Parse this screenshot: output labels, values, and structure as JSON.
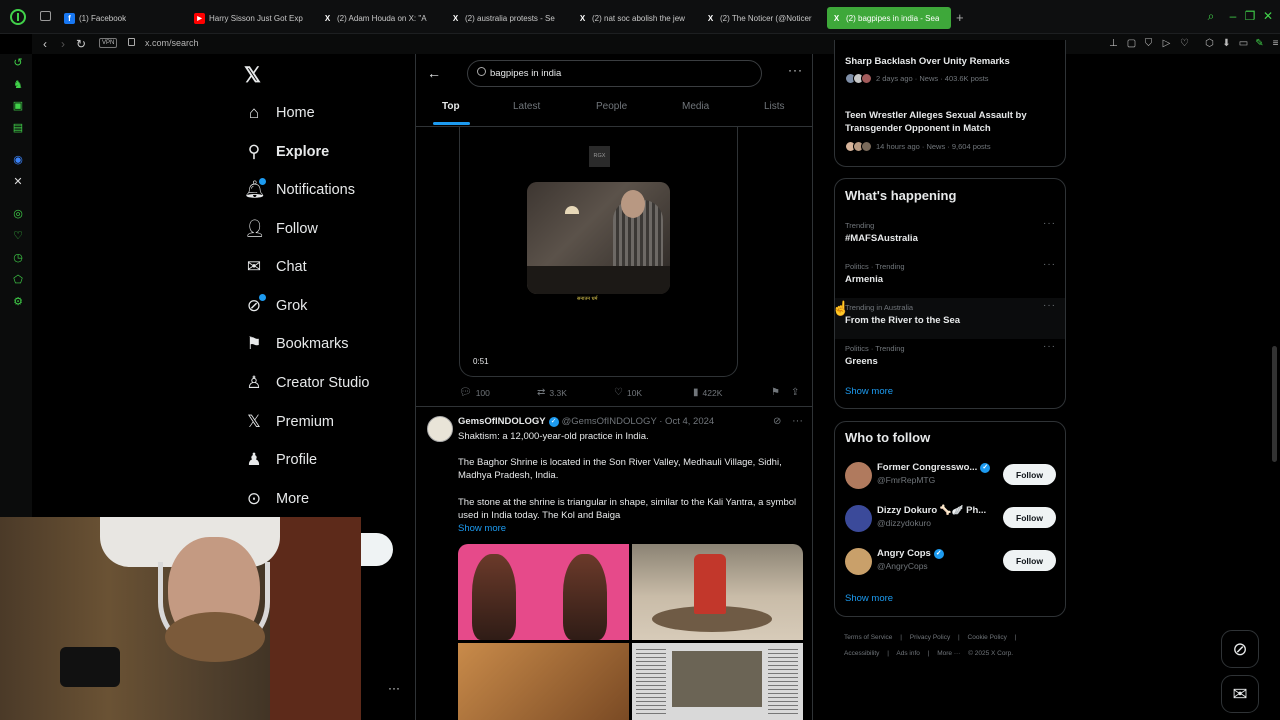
{
  "browser": {
    "tabs": [
      {
        "label": "(1) Facebook",
        "icon_color": "#1877f2",
        "icon": "f"
      },
      {
        "label": "Harry Sisson Just Got Exp",
        "icon_color": "#ff0000",
        "icon": "▶"
      },
      {
        "label": "(2) Adam Houda on X: \"A",
        "icon_color": "#000000",
        "icon": "X"
      },
      {
        "label": "(2) australia protests - Se",
        "icon_color": "#000000",
        "icon": "X"
      },
      {
        "label": "(2) nat soc abolish the jew",
        "icon_color": "#000000",
        "icon": "X"
      },
      {
        "label": "(2) The Noticer (@Noticer",
        "icon_color": "#000000",
        "icon": "X"
      },
      {
        "label": "(2) bagpipes in india - Sea",
        "icon_color": "#000000",
        "icon": "X"
      }
    ],
    "url": "x.com/search",
    "vpn_label": "VPN",
    "accent": "#41d24a"
  },
  "nav": {
    "items": [
      {
        "label": "Home",
        "icon": "home-icon"
      },
      {
        "label": "Explore",
        "icon": "explore-icon"
      },
      {
        "label": "Notifications",
        "icon": "bell-icon"
      },
      {
        "label": "Follow",
        "icon": "follow-icon"
      },
      {
        "label": "Chat",
        "icon": "mail-icon"
      },
      {
        "label": "Grok",
        "icon": "grok-icon"
      },
      {
        "label": "Bookmarks",
        "icon": "bookmark-icon"
      },
      {
        "label": "Creator Studio",
        "icon": "creator-icon"
      },
      {
        "label": "Premium",
        "icon": "x-icon"
      },
      {
        "label": "Profile",
        "icon": "profile-icon"
      },
      {
        "label": "More",
        "icon": "more-icon"
      }
    ]
  },
  "search": {
    "query": "bagpipes in india",
    "tabs": [
      "Top",
      "Latest",
      "People",
      "Media",
      "Lists"
    ]
  },
  "tweet1": {
    "video_logo": "RGX",
    "video_caption": "सनातन धर्म",
    "duration": "0:51",
    "replies": "100",
    "reposts": "3.3K",
    "likes": "10K",
    "views": "422K"
  },
  "tweet2": {
    "name": "GemsOfINDOLOGY",
    "meta": "@GemsOfINDOLOGY · Oct 4, 2024",
    "line1": "Shaktism: a 12,000-year-old practice in India.",
    "para2": "The Baghor Shrine is located in the Son River Valley, Medhauli Village, Sidhi, Madhya Pradesh, India.",
    "para3": "The stone at the shrine is triangular in shape, similar to the Kali Yantra, a symbol used in India today. The Kol and Baiga",
    "show_more": "Show more"
  },
  "news": [
    {
      "title": "Sharp Backlash Over Unity Remarks",
      "meta": "2 days ago · News · 403.6K posts"
    },
    {
      "title": "Teen Wrestler Alleges Sexual Assault by Transgender Opponent in Match",
      "meta": "14 hours ago · News · 9,604 posts"
    }
  ],
  "happening": {
    "title": "What's happening",
    "trends": [
      {
        "category": "Trending",
        "name": "#MAFSAustralia"
      },
      {
        "category": "Politics · Trending",
        "name": "Armenia"
      },
      {
        "category": "Trending in Australia",
        "name": "From the River to the Sea"
      },
      {
        "category": "Politics · Trending",
        "name": "Greens"
      }
    ],
    "show_more": "Show more"
  },
  "who_to_follow": {
    "title": "Who to follow",
    "accounts": [
      {
        "name": "Former Congresswo...",
        "handle": "@FmrRepMTG",
        "verified": true,
        "avatar_color": "#b07a5e"
      },
      {
        "name": "Dizzy Dokuro 🦴🪽 Ph...",
        "handle": "@dizzydokuro",
        "verified": false,
        "avatar_color": "#3b4a9a"
      },
      {
        "name": "Angry Cops",
        "handle": "@AngryCops",
        "verified": true,
        "avatar_color": "#c9a06a"
      }
    ],
    "follow_label": "Follow",
    "show_more": "Show more"
  },
  "footer": {
    "links": [
      "Terms of Service",
      "|",
      "Privacy Policy",
      "|",
      "Cookie Policy",
      "|",
      "Accessibility",
      "|",
      "Ads info",
      "|",
      "More ···",
      "© 2025 X Corp."
    ]
  }
}
